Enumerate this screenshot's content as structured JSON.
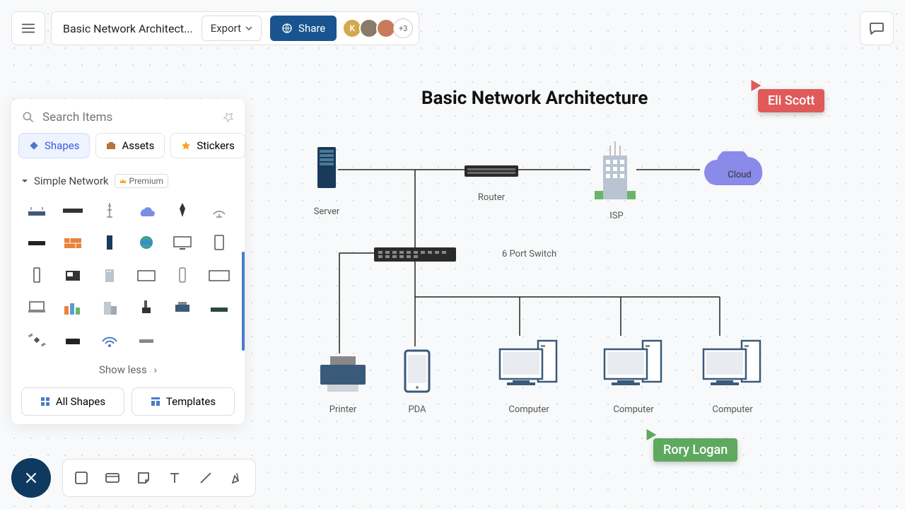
{
  "header": {
    "title": "Basic Network Architect...",
    "export": "Export",
    "share": "Share",
    "more_collaborators": "+3",
    "avatars": [
      {
        "initial": "K",
        "color": "#d4a84b"
      }
    ]
  },
  "sidebar": {
    "search_placeholder": "Search Items",
    "tabs": [
      {
        "label": "Shapes",
        "active": true
      },
      {
        "label": "Assets",
        "active": false
      },
      {
        "label": "Stickers",
        "active": false
      }
    ],
    "section": {
      "title": "Simple Network",
      "badge": "Premium"
    },
    "show_less": "Show less",
    "all_shapes": "All Shapes",
    "templates": "Templates"
  },
  "diagram": {
    "title": "Basic Network Architecture",
    "nodes": {
      "server": "Server",
      "router": "Router",
      "isp": "ISP",
      "cloud": "Cloud",
      "switch": "6 Port Switch",
      "printer": "Printer",
      "pda": "PDA",
      "computer1": "Computer",
      "computer2": "Computer",
      "computer3": "Computer"
    }
  },
  "collaborators": {
    "eli": "Eli Scott",
    "rory": "Rory Logan"
  },
  "colors": {
    "eli": "#e05a5a",
    "rory": "#5fa85f",
    "share": "#1a5490"
  }
}
